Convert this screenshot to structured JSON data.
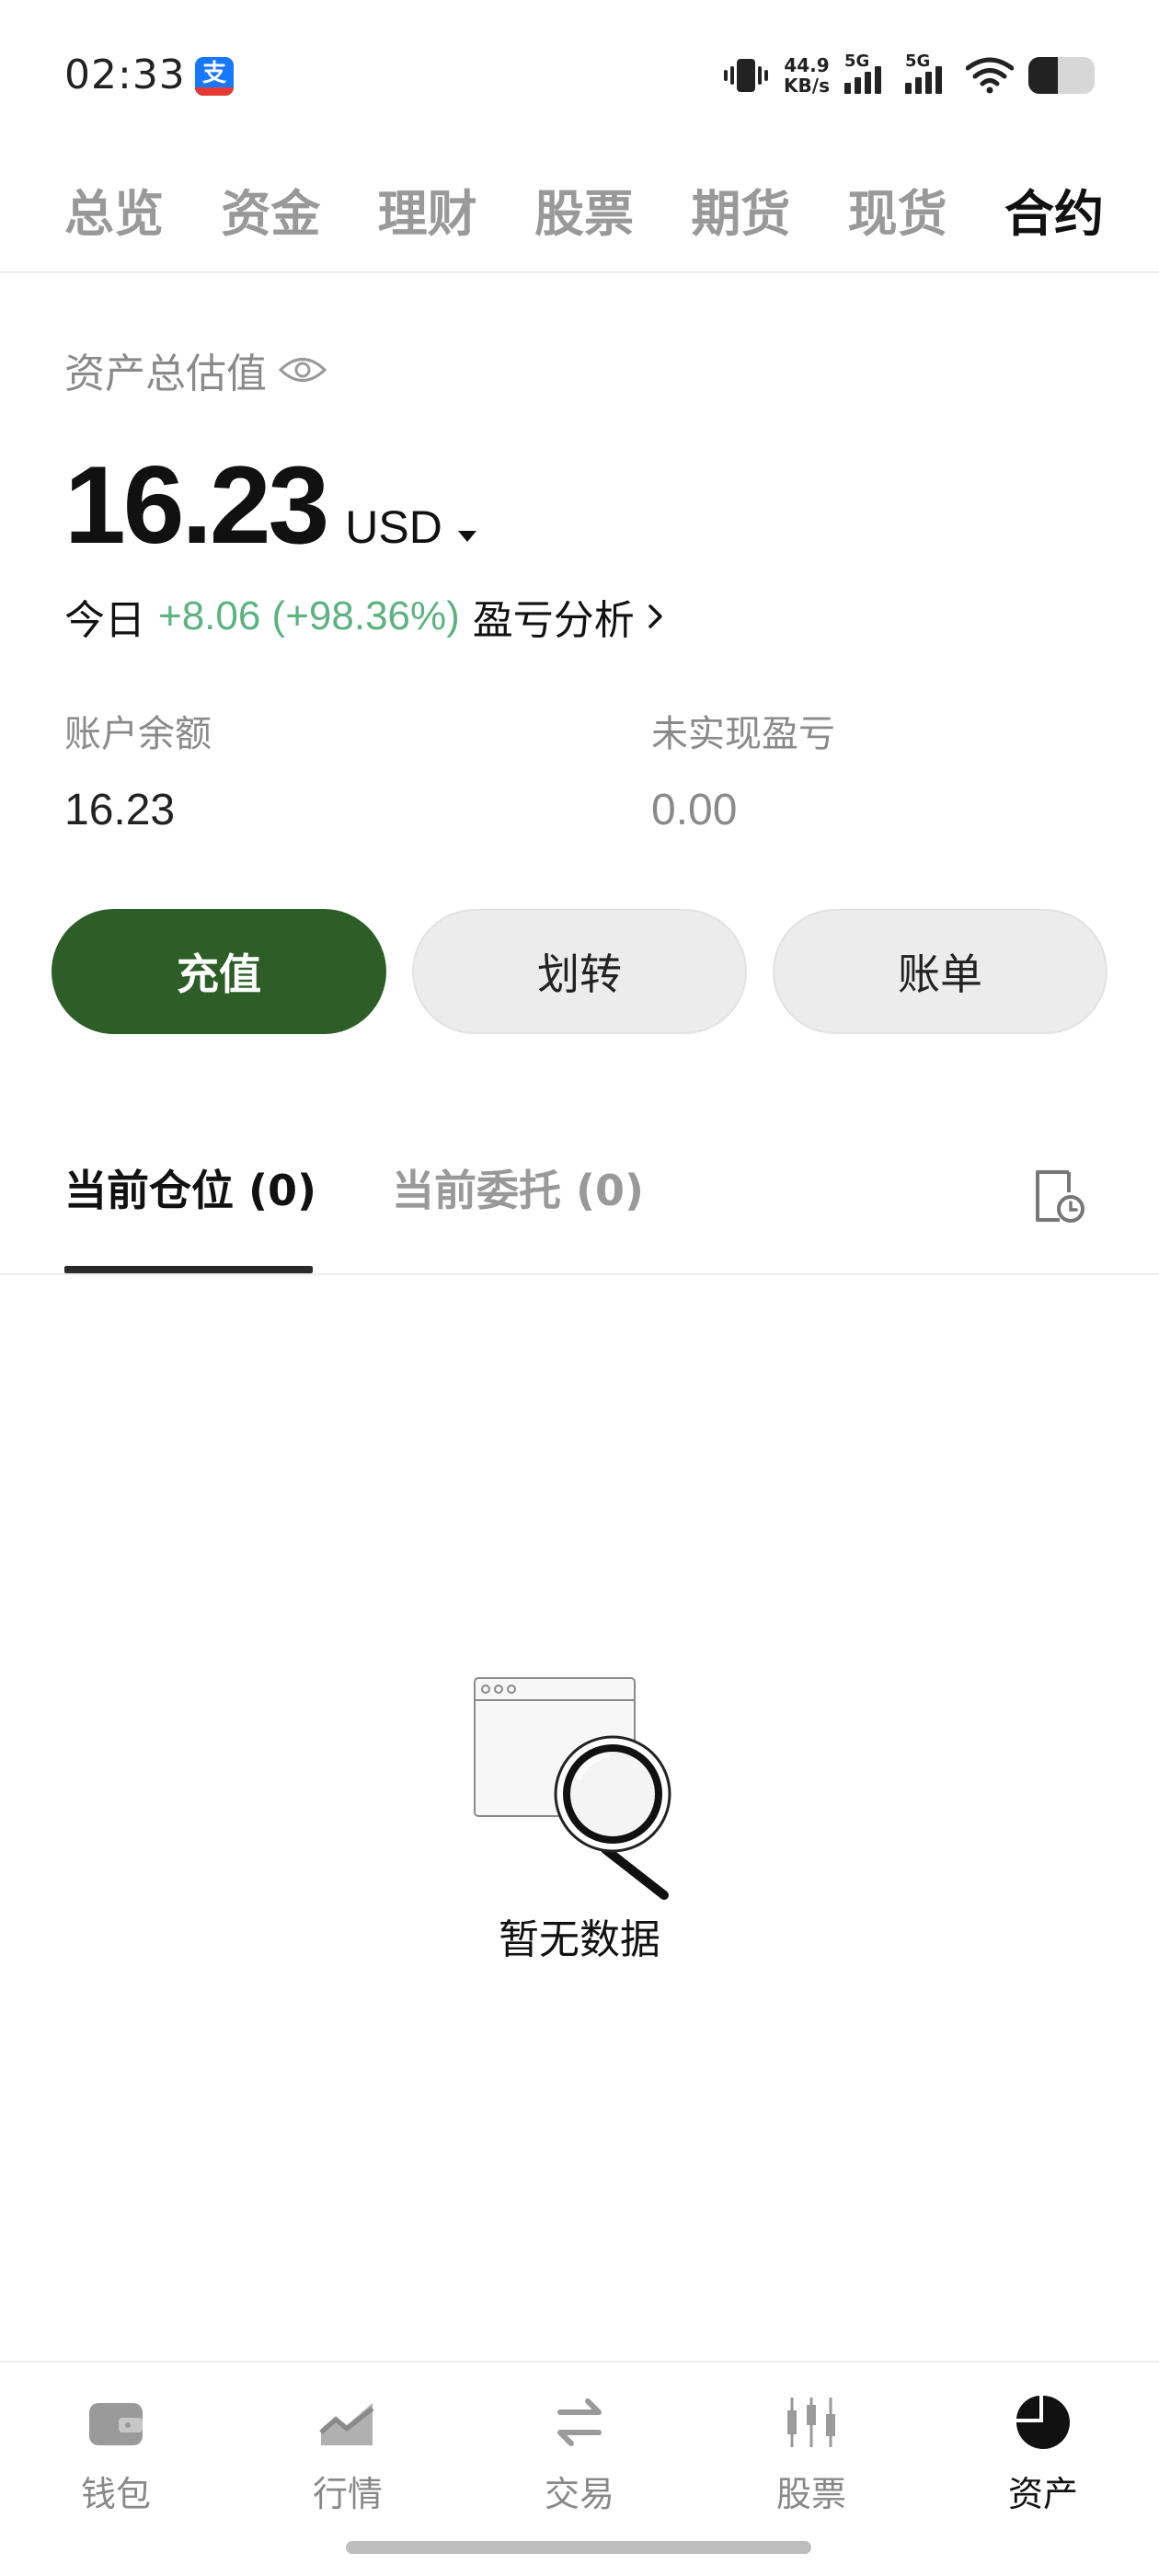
{
  "status_bar": {
    "time": "02:33",
    "app_badge": "支",
    "speed_value": "44.9",
    "speed_unit": "KB/s",
    "signal_1": "5G",
    "signal_2": "5G"
  },
  "top_tabs": [
    "总览",
    "资金",
    "理财",
    "股票",
    "期货",
    "现货",
    "合约"
  ],
  "top_tab_active": "合约",
  "assets": {
    "label": "资产总估值",
    "total": "16.23",
    "currency": "USD",
    "today_label": "今日",
    "today_change": "+8.06 (+98.36%)",
    "analysis": "盈亏分析",
    "balance_label": "账户余额",
    "balance_value": "16.23",
    "unrealized_label": "未实现盈亏",
    "unrealized_value": "0.00"
  },
  "actions": {
    "deposit": "充值",
    "transfer": "划转",
    "bill": "账单"
  },
  "position_tabs": {
    "current_positions": "当前仓位 (0)",
    "current_orders": "当前委托 (0)"
  },
  "empty_state": {
    "text": "暂无数据"
  },
  "bottom_nav": [
    {
      "label": "钱包",
      "icon": "wallet-icon"
    },
    {
      "label": "行情",
      "icon": "market-chart-icon"
    },
    {
      "label": "交易",
      "icon": "swap-arrows-icon"
    },
    {
      "label": "股票",
      "icon": "candlestick-icon"
    },
    {
      "label": "资产",
      "icon": "pie-chart-icon"
    }
  ],
  "bottom_nav_active": "资产",
  "colors": {
    "primary_green": "#2d5e28",
    "gain_green": "#5cb281",
    "inactive_gray": "#999999"
  }
}
